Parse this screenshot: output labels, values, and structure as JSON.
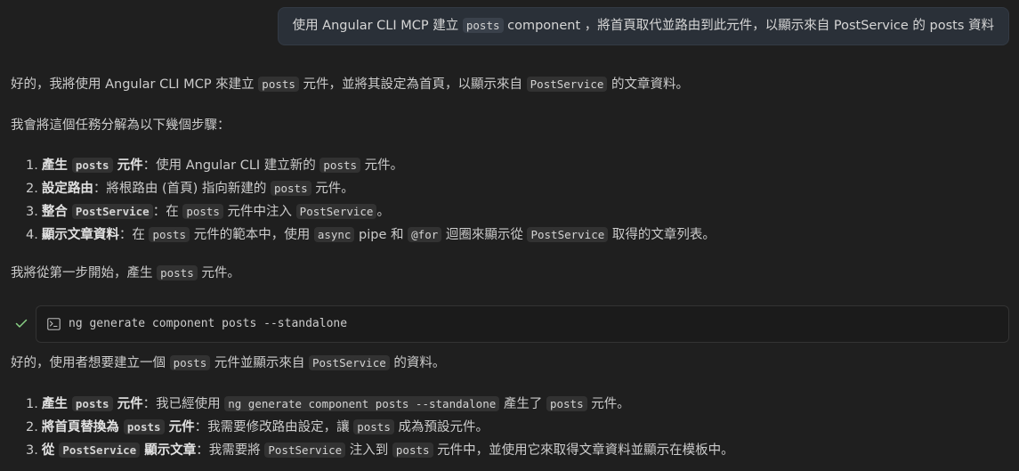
{
  "user_message": {
    "part1": "使用 Angular CLI MCP 建立 ",
    "code1": "posts",
    "part2": " component ，將首頁取代並路由到此元件，以顯示來自 PostService 的 posts 資料"
  },
  "reply1": {
    "intro": {
      "p1": "好的，我將使用 Angular CLI MCP 來建立 ",
      "c1": "posts",
      "p2": " 元件，並將其設定為首頁，以顯示來自 ",
      "c2": "PostService",
      "p3": " 的文章資料。"
    },
    "steps_intro": "我會將這個任務分解為以下幾個步驟：",
    "steps": [
      {
        "num": "1.",
        "title_a": "產生 ",
        "title_code": "posts",
        "title_b": " 元件",
        "p1": "：使用 Angular CLI 建立新的 ",
        "c1": "posts",
        "p2": " 元件。"
      },
      {
        "num": "2.",
        "title": "設定路由",
        "p1": "：將根路由 (首頁) 指向新建的 ",
        "c1": "posts",
        "p2": " 元件。"
      },
      {
        "num": "3.",
        "title_a": "整合 ",
        "title_code": "PostService",
        "p1": "：在 ",
        "c1": "posts",
        "p2": " 元件中注入 ",
        "c2": "PostService",
        "p3": "。"
      },
      {
        "num": "4.",
        "title": "顯示文章資料",
        "p1": "：在 ",
        "c1": "posts",
        "p2": " 元件的範本中，使用 ",
        "c2": "async",
        "p3": " pipe 和 ",
        "c3": "@for",
        "p4": " 迴圈來顯示從 ",
        "c4": "PostService",
        "p5": " 取得的文章列表。"
      }
    ],
    "start": {
      "p1": "我將從第一步開始，產生 ",
      "c1": "posts",
      "p2": " 元件。"
    }
  },
  "tool_call": {
    "status_icon": "check-icon",
    "icon": "terminal-icon",
    "command": "ng generate component posts --standalone",
    "status_color": "#89d185"
  },
  "reply2": {
    "intro": {
      "p1": "好的，使用者想要建立一個 ",
      "c1": "posts",
      "p2": " 元件並顯示來自 ",
      "c2": "PostService",
      "p3": " 的資料。"
    },
    "steps": [
      {
        "num": "1.",
        "title_a": "產生 ",
        "title_code": "posts",
        "title_b": " 元件",
        "p1": "：我已經使用 ",
        "c1": "ng generate component posts --standalone",
        "p2": " 產生了 ",
        "c2": "posts",
        "p3": " 元件。"
      },
      {
        "num": "2.",
        "title_a": "將首頁替換為 ",
        "title_code": "posts",
        "title_b": " 元件",
        "p1": "：我需要修改路由設定，讓 ",
        "c1": "posts",
        "p2": " 成為預設元件。"
      },
      {
        "num": "3.",
        "title_a": "從 ",
        "title_code": "PostService",
        "title_b": " 顯示文章",
        "p1": "：我需要將 ",
        "c1": "PostService",
        "p2": " 注入到 ",
        "c2": "posts",
        "p3": " 元件中，並使用它來取得文章資料並顯示在模板中。"
      }
    ]
  }
}
